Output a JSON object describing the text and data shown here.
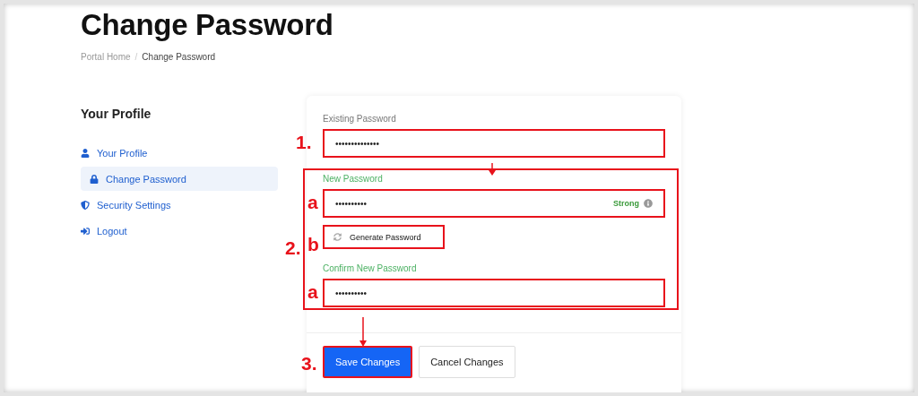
{
  "title": "Change Password",
  "breadcrumb_separator": "/",
  "breadcrumb": [
    {
      "label": "Portal Home",
      "current": false
    },
    {
      "label": "Change Password",
      "current": true
    }
  ],
  "sidebar": {
    "heading": "Your Profile",
    "items": [
      {
        "label": "Your Profile",
        "kind": "user",
        "selected": false
      },
      {
        "label": "Change Password",
        "kind": "lock",
        "selected": true
      },
      {
        "label": "Security Settings",
        "kind": "shield",
        "selected": false
      },
      {
        "label": "Logout",
        "kind": "logout",
        "selected": false
      }
    ]
  },
  "form": {
    "existing": {
      "label": "Existing Password",
      "value": "••••••••••••••",
      "valid": false,
      "marker": "1."
    },
    "group_marker": "2.",
    "new": {
      "label": "New Password",
      "value": "••••••••••",
      "valid": true,
      "marker": "a",
      "strength": "Strong"
    },
    "generate": {
      "label": "Generate Password",
      "marker": "b"
    },
    "confirm": {
      "label": "Confirm New Password",
      "value": "••••••••••",
      "valid": true,
      "marker": "a"
    },
    "buttons": [
      {
        "label": "Save Changes",
        "kind": "primary",
        "marker": "3."
      },
      {
        "label": "Cancel Changes",
        "kind": "secondary"
      }
    ]
  }
}
